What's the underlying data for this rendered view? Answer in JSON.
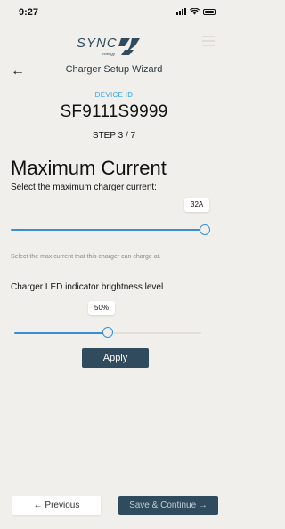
{
  "status_bar": {
    "time": "9:27"
  },
  "brand": {
    "logo_text": "SYNC",
    "tagline": "energy"
  },
  "header": {
    "title": "Charger Setup Wizard"
  },
  "device": {
    "id_label": "DEVICE ID",
    "id": "SF9111S9999"
  },
  "wizard": {
    "step": "STEP 3 / 7"
  },
  "max_current": {
    "title": "Maximum Current",
    "subtitle": "Select the maximum charger current:",
    "value_label": "32A",
    "level": 1.0,
    "hint": "Select the max current that this charger can charge at."
  },
  "led": {
    "label": "Charger LED indicator brightness level",
    "value_label": "50%",
    "level": 0.5
  },
  "actions": {
    "apply": "Apply",
    "previous": "← Previous",
    "save_continue": "Save & Continue →"
  },
  "colors": {
    "background": "#f1efeb",
    "accent_blue": "#3a8fd0",
    "device_label_blue": "#3aa1df",
    "button_dark": "#2f4b5d"
  }
}
